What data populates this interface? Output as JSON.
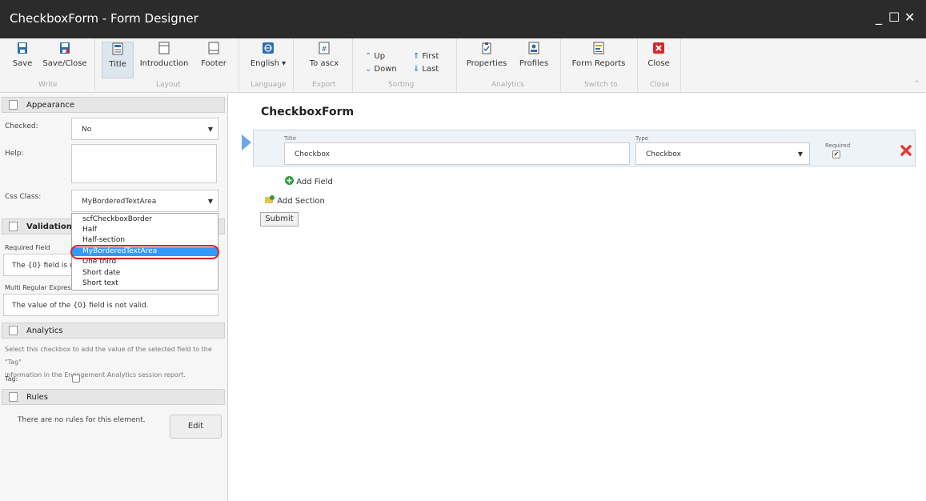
{
  "window": {
    "title": "CheckboxForm - Form Designer",
    "minimize": "_",
    "maximize": "☐",
    "close": "✕"
  },
  "ribbon": {
    "save": "Save",
    "save_close": "Save/Close",
    "group_write": "Write",
    "title": "Title",
    "introduction": "Introduction",
    "footer": "Footer",
    "group_layout": "Layout",
    "language": "English",
    "group_language": "Language",
    "to_ascx": "To ascx",
    "group_export": "Export",
    "up": "Up",
    "down": "Down",
    "first": "First",
    "last": "Last",
    "group_sorting": "Sorting",
    "properties": "Properties",
    "profiles": "Profiles",
    "group_analytics": "Analytics",
    "form_reports": "Form Reports",
    "group_switch": "Switch to",
    "close": "Close",
    "group_close": "Close"
  },
  "panel": {
    "appearance_header": "Appearance",
    "checked_label": "Checked:",
    "checked_value": "No",
    "help_label": "Help:",
    "css_class_label": "Css Class:",
    "css_class_value": "MyBorderedTextArea",
    "css_class_options": [
      "scfCheckboxBorder",
      "Half",
      "Half-section",
      "MyBorderedTextArea",
      "One third",
      "Short date",
      "Short text"
    ],
    "css_class_selected_index": 3,
    "validation_header": "Validation Err",
    "required_field_label": "Required Field",
    "required_field_value": "The {0} field is re",
    "multi_regex_label": "Multi Regular Express",
    "multi_regex_value": "The value of the {0} field is not valid.",
    "analytics_header": "Analytics",
    "analytics_help_1": "Select this checkbox to add the value of the selected field to the \"Tag\"",
    "analytics_help_2": "information in the Engagement Analytics session report.",
    "tag_label": "Tag:",
    "tag_checked": false,
    "rules_header": "Rules",
    "rules_text": "There are no rules for this element.",
    "edit_button": "Edit"
  },
  "form": {
    "name": "CheckboxForm",
    "field": {
      "title_label": "Title",
      "title_value": "Checkbox",
      "type_label": "Type",
      "type_value": "Checkbox",
      "required_label": "Required",
      "required_checked": true
    },
    "add_field": "Add Field",
    "add_section": "Add Section",
    "submit": "Submit"
  }
}
